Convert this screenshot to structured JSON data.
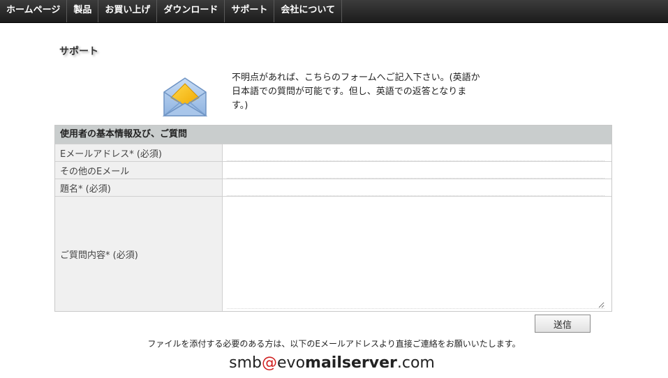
{
  "nav": {
    "items": [
      {
        "label": "ホームページ"
      },
      {
        "label": "製品"
      },
      {
        "label": "お買い上げ"
      },
      {
        "label": "ダウンロード"
      },
      {
        "label": "サポート"
      },
      {
        "label": "会社について"
      }
    ]
  },
  "page": {
    "title": "サポート",
    "intro_line1": "不明点があれば、こちらのフォームへご記入下さい。(英語か",
    "intro_line2": "日本語での質問が可能です。但し、英語での返答となりま",
    "intro_line3": "す。)"
  },
  "icons": {
    "envelope": "envelope-icon"
  },
  "colors": {
    "nav_bg": "#2a2a2a",
    "header_bg": "#c9cdcd",
    "label_bg": "#f0f0f0",
    "email_at": "#d02020"
  },
  "form": {
    "section_title": "使用者の基本情報及び、ご質問",
    "fields": {
      "email_label": "Eメールアドレス* (必須)",
      "email_value": "",
      "other_email_label": "その他のEメール",
      "other_email_value": "",
      "subject_label": "題名* (必須)",
      "subject_value": "",
      "question_label": "ご質問内容* (必須)",
      "question_value": ""
    },
    "submit_label": "送信"
  },
  "footer": {
    "note": "ファイルを添付する必要のある方は、以下のEメールアドレスより直接ご連絡をお願いいたします。",
    "email_user": "smb",
    "email_at": "@",
    "email_domain_plain": "evo",
    "email_domain_bold": "mailserver",
    "email_tld": ".com"
  }
}
